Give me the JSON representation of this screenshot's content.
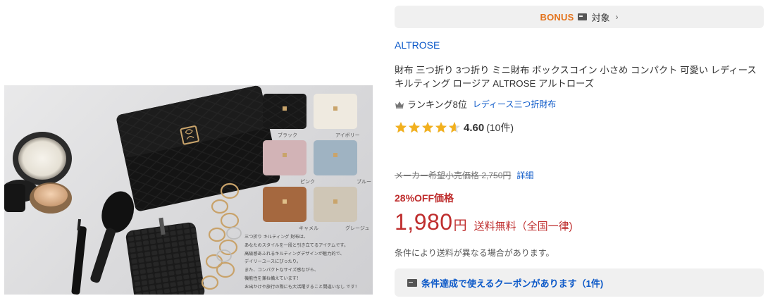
{
  "product_image": {
    "swatch_labels": [
      "ブラック",
      "アイボリー",
      "ピンク",
      "ブルー",
      "キャメル",
      "グレージュ"
    ],
    "description_lines": [
      "三つ折り キルティング 財布は、",
      "あなたのスタイルを一段と引き立てるアイテムです。",
      "高級感あふれるキルティングデザインが魅力的で、",
      "デイリーユースにぴったり。",
      "また、コンパクトなサイズ感ながら、",
      "機能性を兼ね備えています！",
      "お出かけや旅行の際にも大活躍すること間違いなし です！"
    ]
  },
  "bonus": {
    "logo": "BONUS",
    "label": "対象",
    "chevron": "›",
    "logo_color": "#e3731d"
  },
  "brand": "ALTROSE",
  "title": "財布 三つ折り 3つ折り ミニ財布 ボックスコイン 小さめ コンパクト 可愛い レディース キルティング ロージア ALTROSE アルトローズ",
  "ranking": {
    "icon": "crown-icon",
    "label": "ランキング8位",
    "category": "レディース三つ折財布"
  },
  "rating": {
    "value": 4.6,
    "value_text": "4.60",
    "count_text": "(10件)",
    "star_color": "#f2b01e"
  },
  "list_price": {
    "text": "メーカー希望小売価格 2,750円",
    "detail_link": "詳細"
  },
  "discount_label": "28%OFF価格",
  "price": {
    "amount": "1,980",
    "currency": "円",
    "shipping": "送料無料（全国一律)",
    "color": "#bf2e2e"
  },
  "shipping_note": "条件により送料が異なる場合があります。",
  "coupon": {
    "icon": "coupon-icon",
    "text": "条件達成で使えるクーポンがあります（1件)"
  },
  "link_color": "#0b58c8"
}
